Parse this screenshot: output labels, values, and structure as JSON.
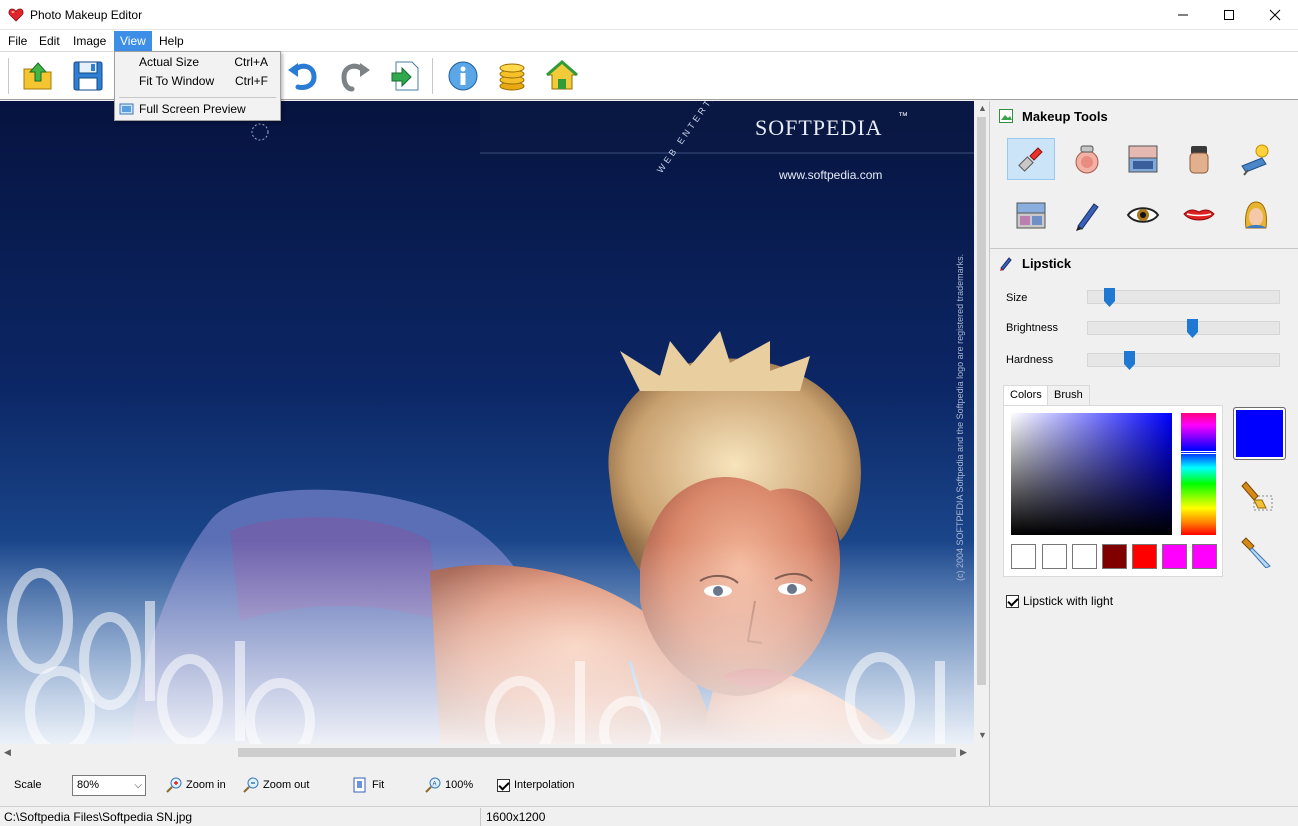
{
  "window": {
    "title": "Photo Makeup Editor"
  },
  "menu": {
    "items": [
      "File",
      "Edit",
      "Image",
      "View",
      "Help"
    ],
    "active": "View"
  },
  "view_menu": {
    "items": [
      {
        "label": "Actual Size",
        "shortcut": "Ctrl+A"
      },
      {
        "label": "Fit To Window",
        "shortcut": "Ctrl+F"
      },
      {
        "label": "Full Screen Preview",
        "shortcut": ""
      }
    ]
  },
  "toolbar": {
    "buttons": [
      "open-icon",
      "save-icon",
      "undo-icon",
      "redo-icon",
      "export-icon",
      "info-icon",
      "coins-icon",
      "home-icon"
    ]
  },
  "canvas": {
    "watermark_brand": "SOFTPEDIA",
    "watermark_tm": "™",
    "watermark_url": "www.softpedia.com",
    "watermark_arc": "WEB ENTERTAINMENT",
    "watermark_side": "(c) 2004 SOFTPEDIA   Softpedia and the Softpedia logo are registered trademarks."
  },
  "bottom_bar": {
    "scale_label": "Scale",
    "scale_value": "80%",
    "zoom_in": "Zoom in",
    "zoom_out": "Zoom out",
    "fit": "Fit",
    "actual": "100%",
    "interpolation": "Interpolation",
    "interpolation_checked": true
  },
  "status": {
    "path": "C:\\Softpedia Files\\Softpedia SN.jpg",
    "dimensions": "1600x1200"
  },
  "panel": {
    "makeup_tools_title": "Makeup Tools",
    "tools": [
      "lipstick-icon",
      "blush-icon",
      "eyeshadow-compact-icon",
      "foundation-icon",
      "tanning-icon",
      "palette-icon",
      "pencil-icon",
      "eye-icon",
      "lips-icon",
      "hair-color-icon"
    ],
    "selected_tool": "lipstick-icon",
    "lipstick_title": "Lipstick",
    "sliders": [
      {
        "label": "Size",
        "value": 0.12
      },
      {
        "label": "Brightness",
        "value": 0.56
      },
      {
        "label": "Hardness",
        "value": 0.22
      }
    ],
    "tabs": [
      "Colors",
      "Brush"
    ],
    "active_tab": "Colors",
    "swatches": [
      "#ffffff",
      "#ffffff",
      "#ffffff",
      "#800000",
      "#ff0000",
      "#ff00ff",
      "#ff00ff"
    ],
    "current_color": "#0000ff",
    "lipstick_with_light": "Lipstick with light",
    "lipstick_with_light_checked": true
  }
}
